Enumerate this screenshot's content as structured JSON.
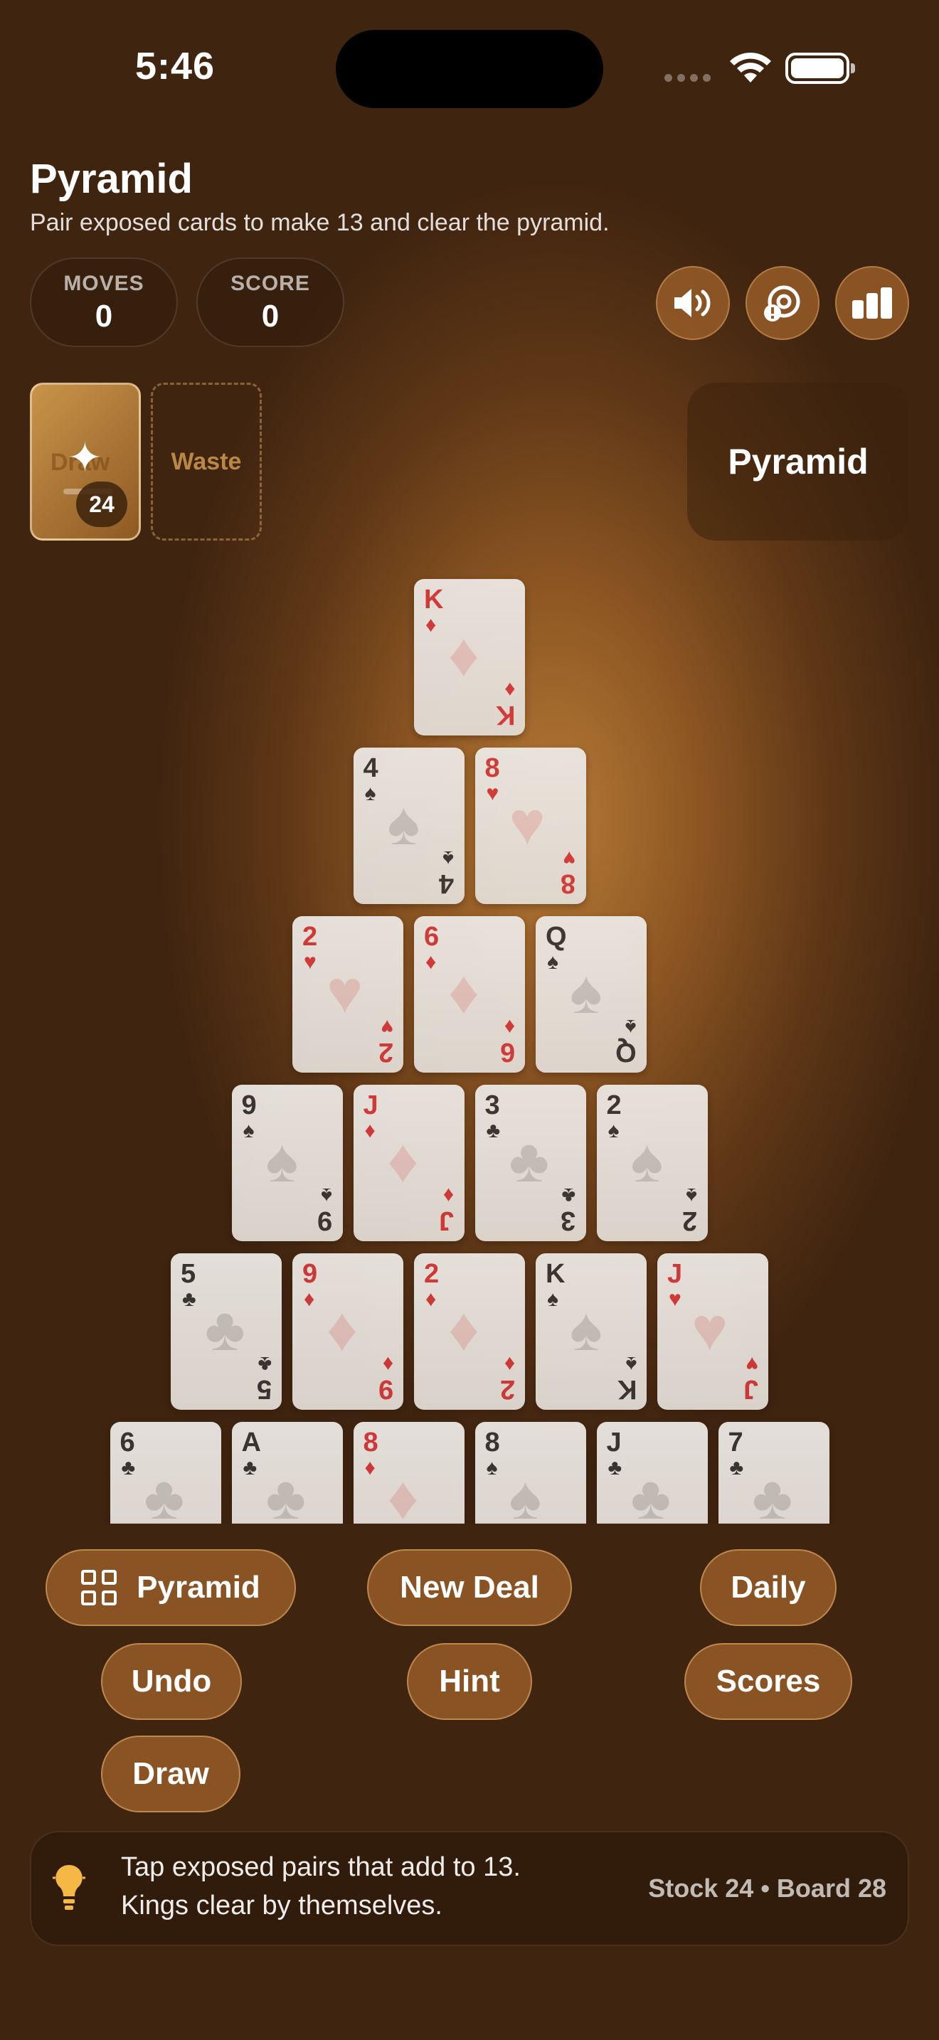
{
  "status": {
    "time": "5:46"
  },
  "header": {
    "title": "Pyramid",
    "subtitle": "Pair exposed cards to make 13 and clear the pyramid."
  },
  "stats": {
    "moves_label": "MOVES",
    "moves_value": "0",
    "score_label": "SCORE",
    "score_value": "0"
  },
  "toolbar_icons": [
    "speaker-icon",
    "help-icon",
    "stats-icon"
  ],
  "stock": {
    "ghost_label": "Draw",
    "count": "24"
  },
  "waste": {
    "label": "Waste"
  },
  "mode_badge": "Pyramid",
  "pyramid": {
    "rows": [
      [
        {
          "rank": "K",
          "suit": "♦",
          "color": "red"
        }
      ],
      [
        {
          "rank": "4",
          "suit": "♠",
          "color": "black"
        },
        {
          "rank": "8",
          "suit": "♥",
          "color": "red"
        }
      ],
      [
        {
          "rank": "2",
          "suit": "♥",
          "color": "red"
        },
        {
          "rank": "6",
          "suit": "♦",
          "color": "red"
        },
        {
          "rank": "Q",
          "suit": "♠",
          "color": "black"
        }
      ],
      [
        {
          "rank": "9",
          "suit": "♠",
          "color": "black"
        },
        {
          "rank": "J",
          "suit": "♦",
          "color": "red"
        },
        {
          "rank": "3",
          "suit": "♣",
          "color": "black"
        },
        {
          "rank": "2",
          "suit": "♠",
          "color": "black"
        }
      ],
      [
        {
          "rank": "5",
          "suit": "♣",
          "color": "black"
        },
        {
          "rank": "9",
          "suit": "♦",
          "color": "red"
        },
        {
          "rank": "2",
          "suit": "♦",
          "color": "red"
        },
        {
          "rank": "K",
          "suit": "♠",
          "color": "black"
        },
        {
          "rank": "J",
          "suit": "♥",
          "color": "red"
        }
      ],
      [
        {
          "rank": "6",
          "suit": "♣",
          "color": "black"
        },
        {
          "rank": "A",
          "suit": "♣",
          "color": "black"
        },
        {
          "rank": "8",
          "suit": "♦",
          "color": "red"
        },
        {
          "rank": "8",
          "suit": "♠",
          "color": "black"
        },
        {
          "rank": "J",
          "suit": "♣",
          "color": "black"
        },
        {
          "rank": "7",
          "suit": "♣",
          "color": "black"
        }
      ]
    ]
  },
  "buttons": {
    "pyramid": "Pyramid",
    "new_deal": "New Deal",
    "daily": "Daily",
    "undo": "Undo",
    "hint": "Hint",
    "scores": "Scores",
    "draw": "Draw"
  },
  "hint": {
    "line1": "Tap exposed pairs that add to 13.",
    "line2": "Kings clear by themselves.",
    "counts": "Stock 24 • Board 28"
  },
  "colors": {
    "red_suit": "#d43a3a",
    "black_suit": "#3a3632",
    "accent": "#965c28",
    "bulb": "#f6b845"
  }
}
